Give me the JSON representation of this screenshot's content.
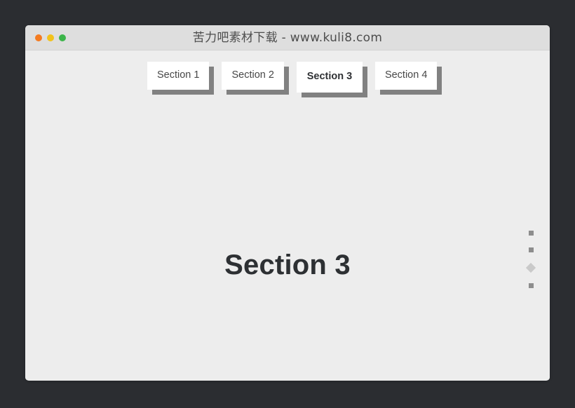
{
  "window": {
    "titlebar": {
      "title": "苦力吧素材下载 - www.kuli8.com",
      "controls": [
        {
          "name": "close-button",
          "icon": "close-dot-icon",
          "color": "#f47b20"
        },
        {
          "name": "minimize-button",
          "icon": "minimize-dot-icon",
          "color": "#f2c21b"
        },
        {
          "name": "zoom-button",
          "icon": "zoom-dot-icon",
          "color": "#3cb54a"
        }
      ]
    }
  },
  "tabs": [
    {
      "label": "Section 1",
      "active": false
    },
    {
      "label": "Section 2",
      "active": false
    },
    {
      "label": "Section 3",
      "active": true
    },
    {
      "label": "Section 4",
      "active": false
    }
  ],
  "main": {
    "heading": "Section 3"
  },
  "slide_nav": {
    "items": [
      {
        "shape": "square",
        "active": false
      },
      {
        "shape": "square",
        "active": false
      },
      {
        "shape": "diamond",
        "active": true
      },
      {
        "shape": "square",
        "active": false
      }
    ],
    "active_index": 3,
    "count": 4
  },
  "colors": {
    "desktop_background": "#2b2d31",
    "titlebar": "#dedede",
    "page_background": "#ededed",
    "tab_face": "#ffffff",
    "tab_shadow": "#818181",
    "heading_text": "#2d3033",
    "title_text": "#4d4d4d",
    "nav_dot": "#8d8d8d",
    "nav_dot_active": "#c9c9c9"
  }
}
